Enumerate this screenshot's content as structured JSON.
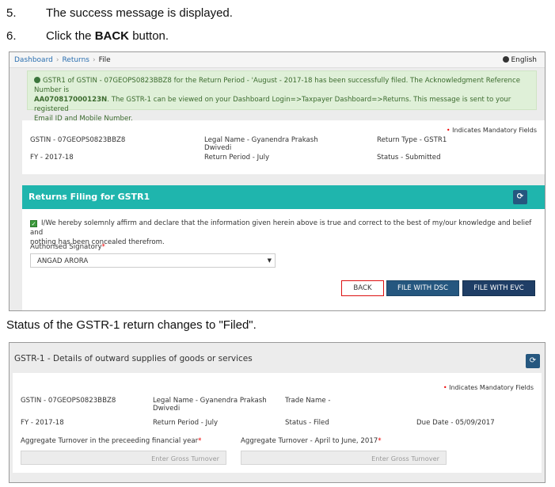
{
  "steps": [
    {
      "num": "5.",
      "text": "The success message is displayed."
    },
    {
      "num": "6.",
      "pre": "Click the ",
      "bold": "BACK",
      "post": " button."
    }
  ],
  "caption": "Status of the GSTR-1 return changes to \"Filed\".",
  "screen1": {
    "breadcrumb": [
      "Dashboard",
      "Returns",
      "File"
    ],
    "language": "English",
    "success": {
      "line1": "GSTR1 of GSTIN - 07GEOPS0823BBZ8 for the Return Period - 'August - 2017-18 has been successfully filed. The Acknowledgment Reference Number is",
      "arn": "AA070817000123N",
      "line2": ". The GSTR-1 can be viewed on your Dashboard Login=>Taxpayer Dashboard=>Returns. This message is sent to your registered",
      "line3": "Email ID and Mobile Number."
    },
    "mandatory_note": "Indicates Mandatory Fields",
    "info": {
      "gstin": "GSTIN - 07GEOPS0823BBZ8",
      "legal_name_1": "Legal Name - Gyanendra Prakash",
      "legal_name_2": "Dwivedi",
      "return_type": "Return Type - GSTR1",
      "fy": "FY - 2017-18",
      "return_period": "Return Period - July",
      "status": "Status - Submitted"
    },
    "panel_title": "Returns Filing for GSTR1",
    "declaration_1": "I/We hereby solemnly affirm and declare that the information given herein above is true and correct to the best of my/our knowledge and belief and",
    "declaration_2": "nothing has been concealed therefrom.",
    "signatory_label": "Authorised Signatory",
    "signatory_value": "ANGAD ARORA",
    "buttons": {
      "back": "BACK",
      "dsc": "FILE WITH DSC",
      "evc": "FILE WITH EVC"
    }
  },
  "screen2": {
    "title": "GSTR-1 - Details of outward supplies of goods or services",
    "mandatory_note": "Indicates Mandatory Fields",
    "gstin": "GSTIN - 07GEOPS0823BBZ8",
    "legal_name_1": "Legal Name - Gyanendra Prakash",
    "legal_name_2": "Dwivedi",
    "trade_name": "Trade Name -",
    "fy": "FY - 2017-18",
    "return_period": "Return Period -  July",
    "status": "Status - Filed",
    "due_date": "Due Date -  05/09/2017",
    "turnover_prev_label": "Aggregate Turnover in the preceeding financial year",
    "turnover_q1_label": "Aggregate Turnover - April to June, 2017",
    "placeholder": "Enter Gross Turnover"
  }
}
